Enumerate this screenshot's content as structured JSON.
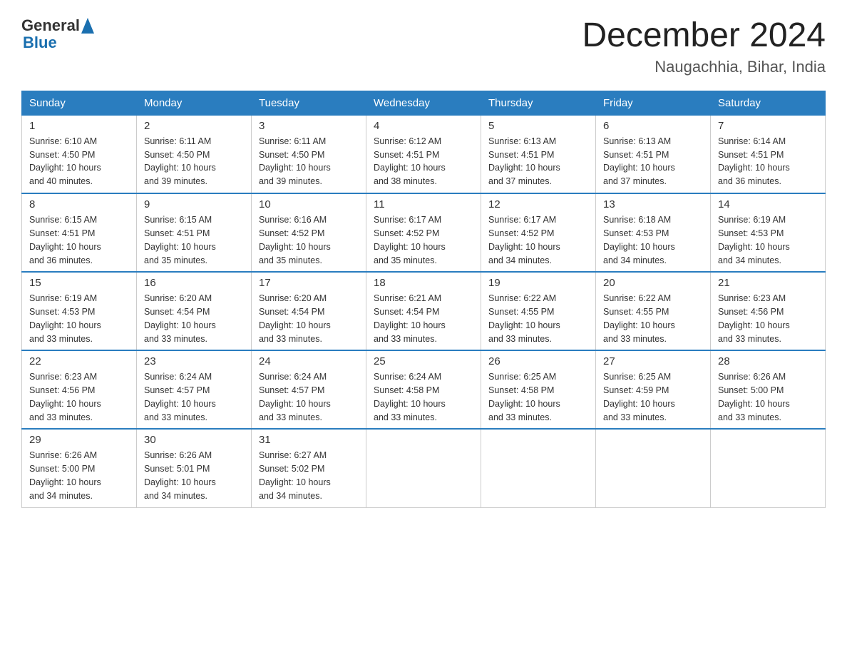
{
  "logo": {
    "general": "General",
    "blue": "Blue"
  },
  "header": {
    "month": "December 2024",
    "location": "Naugachhia, Bihar, India"
  },
  "days_of_week": [
    "Sunday",
    "Monday",
    "Tuesday",
    "Wednesday",
    "Thursday",
    "Friday",
    "Saturday"
  ],
  "weeks": [
    [
      {
        "day": "1",
        "info": "Sunrise: 6:10 AM\nSunset: 4:50 PM\nDaylight: 10 hours\nand 40 minutes."
      },
      {
        "day": "2",
        "info": "Sunrise: 6:11 AM\nSunset: 4:50 PM\nDaylight: 10 hours\nand 39 minutes."
      },
      {
        "day": "3",
        "info": "Sunrise: 6:11 AM\nSunset: 4:50 PM\nDaylight: 10 hours\nand 39 minutes."
      },
      {
        "day": "4",
        "info": "Sunrise: 6:12 AM\nSunset: 4:51 PM\nDaylight: 10 hours\nand 38 minutes."
      },
      {
        "day": "5",
        "info": "Sunrise: 6:13 AM\nSunset: 4:51 PM\nDaylight: 10 hours\nand 37 minutes."
      },
      {
        "day": "6",
        "info": "Sunrise: 6:13 AM\nSunset: 4:51 PM\nDaylight: 10 hours\nand 37 minutes."
      },
      {
        "day": "7",
        "info": "Sunrise: 6:14 AM\nSunset: 4:51 PM\nDaylight: 10 hours\nand 36 minutes."
      }
    ],
    [
      {
        "day": "8",
        "info": "Sunrise: 6:15 AM\nSunset: 4:51 PM\nDaylight: 10 hours\nand 36 minutes."
      },
      {
        "day": "9",
        "info": "Sunrise: 6:15 AM\nSunset: 4:51 PM\nDaylight: 10 hours\nand 35 minutes."
      },
      {
        "day": "10",
        "info": "Sunrise: 6:16 AM\nSunset: 4:52 PM\nDaylight: 10 hours\nand 35 minutes."
      },
      {
        "day": "11",
        "info": "Sunrise: 6:17 AM\nSunset: 4:52 PM\nDaylight: 10 hours\nand 35 minutes."
      },
      {
        "day": "12",
        "info": "Sunrise: 6:17 AM\nSunset: 4:52 PM\nDaylight: 10 hours\nand 34 minutes."
      },
      {
        "day": "13",
        "info": "Sunrise: 6:18 AM\nSunset: 4:53 PM\nDaylight: 10 hours\nand 34 minutes."
      },
      {
        "day": "14",
        "info": "Sunrise: 6:19 AM\nSunset: 4:53 PM\nDaylight: 10 hours\nand 34 minutes."
      }
    ],
    [
      {
        "day": "15",
        "info": "Sunrise: 6:19 AM\nSunset: 4:53 PM\nDaylight: 10 hours\nand 33 minutes."
      },
      {
        "day": "16",
        "info": "Sunrise: 6:20 AM\nSunset: 4:54 PM\nDaylight: 10 hours\nand 33 minutes."
      },
      {
        "day": "17",
        "info": "Sunrise: 6:20 AM\nSunset: 4:54 PM\nDaylight: 10 hours\nand 33 minutes."
      },
      {
        "day": "18",
        "info": "Sunrise: 6:21 AM\nSunset: 4:54 PM\nDaylight: 10 hours\nand 33 minutes."
      },
      {
        "day": "19",
        "info": "Sunrise: 6:22 AM\nSunset: 4:55 PM\nDaylight: 10 hours\nand 33 minutes."
      },
      {
        "day": "20",
        "info": "Sunrise: 6:22 AM\nSunset: 4:55 PM\nDaylight: 10 hours\nand 33 minutes."
      },
      {
        "day": "21",
        "info": "Sunrise: 6:23 AM\nSunset: 4:56 PM\nDaylight: 10 hours\nand 33 minutes."
      }
    ],
    [
      {
        "day": "22",
        "info": "Sunrise: 6:23 AM\nSunset: 4:56 PM\nDaylight: 10 hours\nand 33 minutes."
      },
      {
        "day": "23",
        "info": "Sunrise: 6:24 AM\nSunset: 4:57 PM\nDaylight: 10 hours\nand 33 minutes."
      },
      {
        "day": "24",
        "info": "Sunrise: 6:24 AM\nSunset: 4:57 PM\nDaylight: 10 hours\nand 33 minutes."
      },
      {
        "day": "25",
        "info": "Sunrise: 6:24 AM\nSunset: 4:58 PM\nDaylight: 10 hours\nand 33 minutes."
      },
      {
        "day": "26",
        "info": "Sunrise: 6:25 AM\nSunset: 4:58 PM\nDaylight: 10 hours\nand 33 minutes."
      },
      {
        "day": "27",
        "info": "Sunrise: 6:25 AM\nSunset: 4:59 PM\nDaylight: 10 hours\nand 33 minutes."
      },
      {
        "day": "28",
        "info": "Sunrise: 6:26 AM\nSunset: 5:00 PM\nDaylight: 10 hours\nand 33 minutes."
      }
    ],
    [
      {
        "day": "29",
        "info": "Sunrise: 6:26 AM\nSunset: 5:00 PM\nDaylight: 10 hours\nand 34 minutes."
      },
      {
        "day": "30",
        "info": "Sunrise: 6:26 AM\nSunset: 5:01 PM\nDaylight: 10 hours\nand 34 minutes."
      },
      {
        "day": "31",
        "info": "Sunrise: 6:27 AM\nSunset: 5:02 PM\nDaylight: 10 hours\nand 34 minutes."
      },
      null,
      null,
      null,
      null
    ]
  ]
}
